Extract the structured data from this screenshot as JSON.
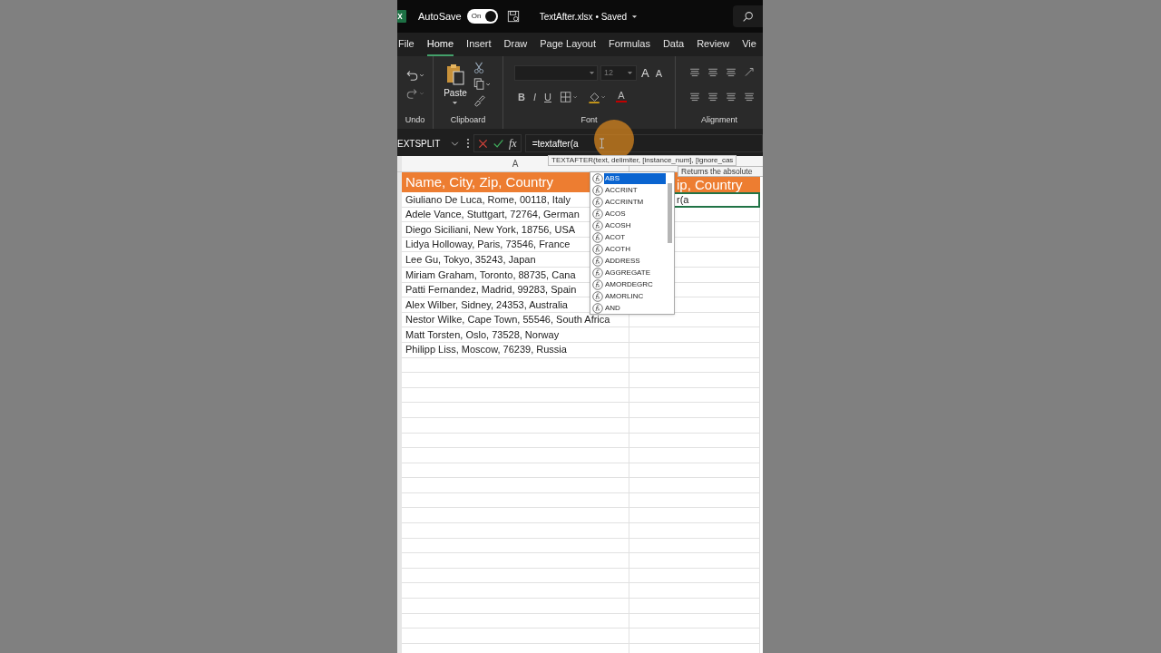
{
  "title_bar": {
    "autosave_label": "AutoSave",
    "autosave_on": true,
    "autosave_state": "On",
    "file_name": "TextAfter.xlsx • Saved"
  },
  "ribbon_tabs": [
    {
      "label": "File",
      "selected": false
    },
    {
      "label": "Home",
      "selected": true
    },
    {
      "label": "Insert",
      "selected": false
    },
    {
      "label": "Draw",
      "selected": false
    },
    {
      "label": "Page Layout",
      "selected": false
    },
    {
      "label": "Formulas",
      "selected": false
    },
    {
      "label": "Data",
      "selected": false
    },
    {
      "label": "Review",
      "selected": false
    },
    {
      "label": "Vie",
      "selected": false
    }
  ],
  "ribbon": {
    "paste_label": "Paste",
    "font_size": "12",
    "font_buttons_top": [
      {
        "kind": "grow",
        "glyph": "A"
      },
      {
        "kind": "shrink",
        "glyph": "A"
      }
    ],
    "font_buttons_bottom": [
      {
        "kind": "bold",
        "glyph": "B"
      },
      {
        "kind": "italic",
        "glyph": "I"
      },
      {
        "kind": "underline",
        "glyph": "U"
      }
    ],
    "font_color_glyph": "A",
    "group_labels": [
      "Undo",
      "Clipboard",
      "Font",
      "Alignment"
    ]
  },
  "formula_bar": {
    "name_box": "EXTSPLIT",
    "fx": "fx",
    "formula": "=textafter(a"
  },
  "column_headers": [
    "A"
  ],
  "header_row": {
    "column_a": "Name, City, Zip, Country",
    "column_b": "ip, Country"
  },
  "rows": [
    "Giuliano De Luca, Rome, 00118, Italy",
    "Adele Vance, Stuttgart, 72764, German",
    "Diego Siciliani, New York, 18756, USA",
    "Lidya Holloway, Paris, 73546, France",
    "Lee Gu, Tokyo, 35243, Japan",
    "Miriam Graham, Toronto, 88735, Cana",
    "Patti Fernandez, Madrid, 99283, Spain",
    "Alex Wilber, Sidney, 24353, Australia",
    "Nestor Wilke, Cape Town, 55546, South Africa",
    "Matt Torsten, Oslo, 73528, Norway",
    "Philipp Liss, Moscow, 76239, Russia"
  ],
  "active_cell_text": "r(a",
  "syntax_tooltip": "TEXTAFTER(text, delimiter, [instance_num], [ignore_cas",
  "autocomplete": [
    {
      "name": "ABS",
      "selected": true
    },
    {
      "name": "ACCRINT",
      "selected": false
    },
    {
      "name": "ACCRINTM",
      "selected": false
    },
    {
      "name": "ACOS",
      "selected": false
    },
    {
      "name": "ACOSH",
      "selected": false
    },
    {
      "name": "ACOT",
      "selected": false
    },
    {
      "name": "ACOTH",
      "selected": false
    },
    {
      "name": "ADDRESS",
      "selected": false
    },
    {
      "name": "AGGREGATE",
      "selected": false
    },
    {
      "name": "AMORDEGRC",
      "selected": false
    },
    {
      "name": "AMORLINC",
      "selected": false
    },
    {
      "name": "AND",
      "selected": false
    }
  ],
  "description_tip": "Returns the absolute"
}
